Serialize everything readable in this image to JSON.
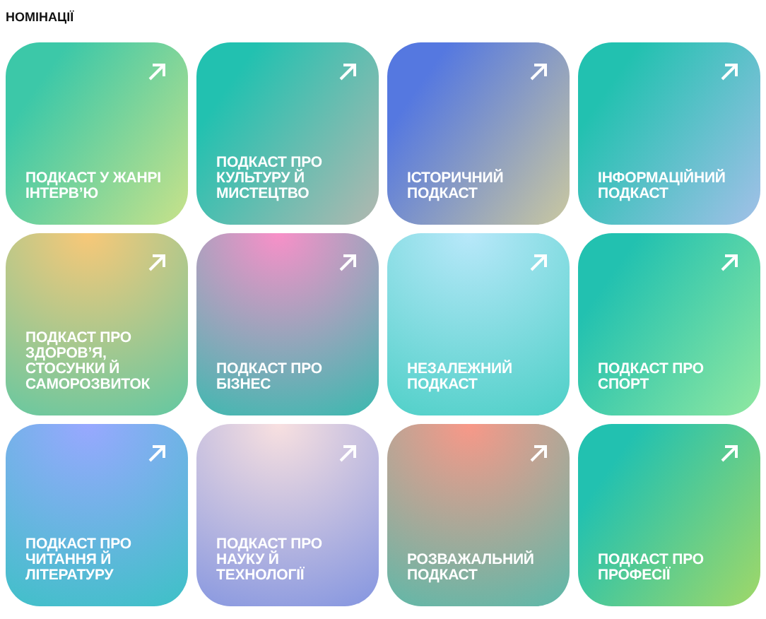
{
  "heading": "НОМІНАЦІЇ",
  "cards": [
    {
      "title": "ПОДКАСТ У ЖАНРІ ІНТЕРВ’Ю",
      "kind": "lime"
    },
    {
      "title": "ПОДКАСТ ПРО КУЛЬТУРУ Й МИСТЕЦТВО",
      "kind": "sage"
    },
    {
      "title": "ІСТОРИЧНИЙ ПОДКАСТ",
      "kind": "cobalt"
    },
    {
      "title": "ІНФОРМАЦІЙНИЙ ПОДКАСТ",
      "kind": "sky"
    },
    {
      "title": "ПОДКАСТ ПРО ЗДОРОВ’Я, СТОСУНКИ Й САМОРОЗВИТОК",
      "kind": "amber"
    },
    {
      "title": "ПОДКАСТ ПРО БІЗНЕС",
      "kind": "rose"
    },
    {
      "title": "НЕЗАЛЕЖНИЙ ПОДКАСТ",
      "kind": "ice"
    },
    {
      "title": "ПОДКАСТ ПРО СПОРТ",
      "kind": "mint"
    },
    {
      "title": "ПОДКАСТ ПРО ЧИТАННЯ Й ЛІТЕРАТУРУ",
      "kind": "periwinkle"
    },
    {
      "title": "ПОДКАСТ ПРО НАУКУ Й ТЕХНОЛОГІЇ",
      "kind": "blush"
    },
    {
      "title": "РОЗВАЖАЛЬНИЙ ПОДКАСТ",
      "kind": "coral"
    },
    {
      "title": "ПОДКАСТ ПРО ПРОФЕСІЇ",
      "kind": "meadow"
    }
  ]
}
